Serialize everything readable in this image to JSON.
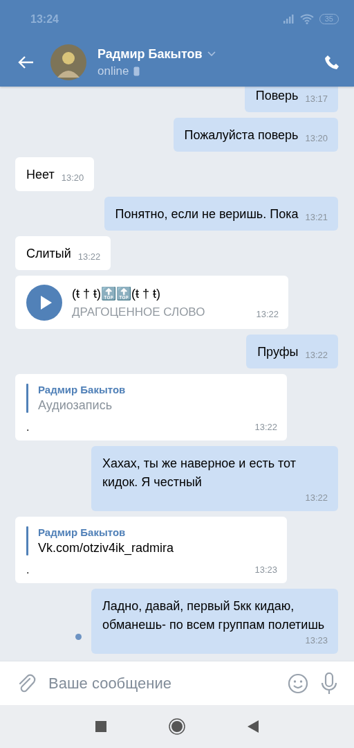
{
  "status_bar": {
    "time": "13:24",
    "battery": "35"
  },
  "header": {
    "name": "Радмир Бакытов",
    "status": "online"
  },
  "messages": [
    {
      "kind": "text",
      "outgoing": true,
      "text": "Поверь",
      "time": "13:17",
      "unread": false
    },
    {
      "kind": "text",
      "outgoing": true,
      "text": "Пожалуйста поверь",
      "time": "13:20",
      "unread": false
    },
    {
      "kind": "text",
      "outgoing": false,
      "text": "Неет",
      "time": "13:20",
      "unread": false
    },
    {
      "kind": "text",
      "outgoing": true,
      "text": "Понятно, если не веришь. Пока",
      "time": "13:21",
      "unread": false
    },
    {
      "kind": "text",
      "outgoing": false,
      "text": "Слитый",
      "time": "13:22",
      "unread": false
    },
    {
      "kind": "audio",
      "outgoing": false,
      "title": "(ŧ † ŧ)🔝🔝(ŧ † ŧ)",
      "artist": "ДРАГОЦЕННОЕ СЛОВО",
      "time": "13:22",
      "unread": false
    },
    {
      "kind": "text",
      "outgoing": true,
      "text": "Пруфы",
      "time": "13:22",
      "unread": false
    },
    {
      "kind": "forward",
      "outgoing": false,
      "author": "Радмир Бакытов",
      "quote": "Аудиозапись",
      "attachment": true,
      "text": ".",
      "time": "13:22",
      "unread": false
    },
    {
      "kind": "text",
      "outgoing": true,
      "text": "Хахах, ты же наверное и есть тот кидок. Я честный",
      "time": "13:22",
      "unread": false
    },
    {
      "kind": "forward",
      "outgoing": false,
      "author": "Радмир Бакытов",
      "quote": "Vk.com/otziv4ik_radmira",
      "attachment": false,
      "text": ".",
      "time": "13:23",
      "unread": false
    },
    {
      "kind": "text",
      "outgoing": true,
      "text": "Ладно, давай, первый 5кк кидаю, обманешь- по всем группам полетишь",
      "time": "13:23",
      "unread": true
    }
  ],
  "composer": {
    "placeholder": "Ваше сообщение"
  }
}
